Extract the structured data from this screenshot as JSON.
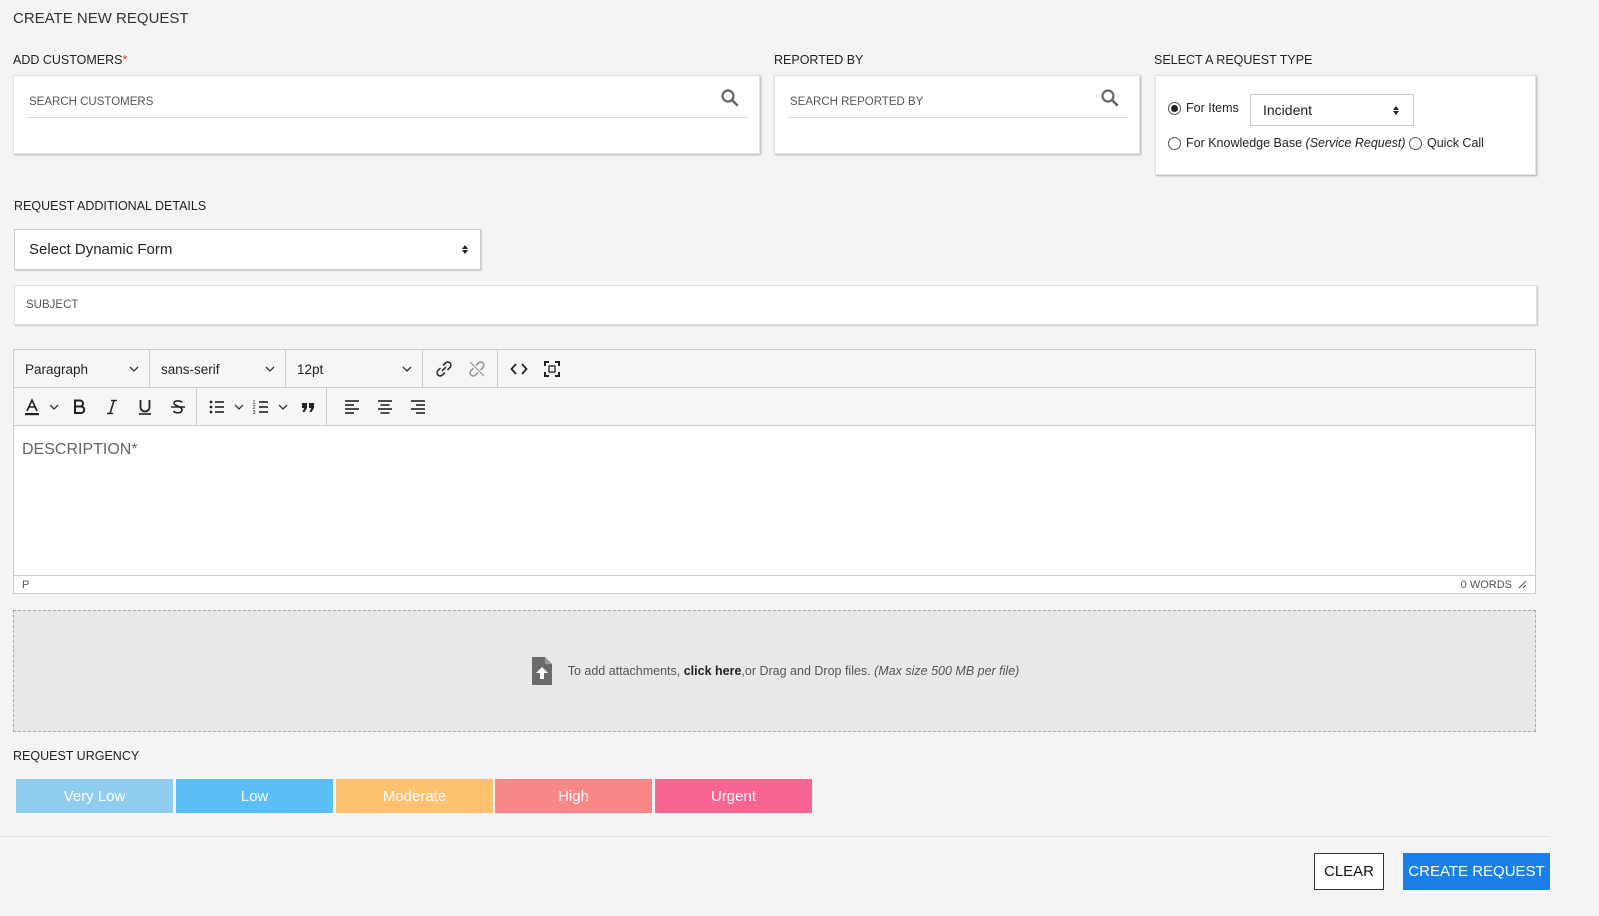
{
  "page": {
    "title": "CREATE NEW REQUEST"
  },
  "customers": {
    "label": "ADD CUSTOMERS",
    "required_mark": "*",
    "placeholder": "SEARCH CUSTOMERS"
  },
  "reported_by": {
    "label": "REPORTED BY",
    "placeholder": "SEARCH REPORTED BY"
  },
  "request_type": {
    "label": "SELECT A REQUEST TYPE",
    "option_items": "For Items",
    "option_items_selected": true,
    "items_select_value": "Incident",
    "option_kb": "For Knowledge Base",
    "option_kb_note": "(Service Request)",
    "option_quick": "Quick Call"
  },
  "additional": {
    "label": "REQUEST ADDITIONAL DETAILS",
    "dynamic_form_value": "Select Dynamic Form"
  },
  "subject": {
    "placeholder": "SUBJECT"
  },
  "editor": {
    "block_format": "Paragraph",
    "font_family": "sans-serif",
    "font_size": "12pt",
    "placeholder": "DESCRIPTION*",
    "path": "P",
    "word_count": "0 WORDS",
    "icons_row1": [
      "link-icon",
      "unlink-icon",
      "source-code-icon",
      "fullscreen-icon"
    ],
    "icons_row2": [
      "text-color-icon",
      "bold-icon",
      "italic-icon",
      "underline-icon",
      "strikethrough-icon",
      "bullet-list-icon",
      "numbered-list-icon",
      "blockquote-icon",
      "align-left-icon",
      "align-center-icon",
      "align-right-icon"
    ]
  },
  "attachments": {
    "prefix": "To add attachments, ",
    "link": "click here",
    "middle": ",or Drag and Drop files. ",
    "note": "(Max size 500 MB per file)"
  },
  "urgency": {
    "label": "REQUEST URGENCY",
    "levels": [
      {
        "label": "Very Low",
        "color": "#8fcdf0"
      },
      {
        "label": "Low",
        "color": "#5bbef5"
      },
      {
        "label": "Moderate",
        "color": "#fec170"
      },
      {
        "label": "High",
        "color": "#f98787"
      },
      {
        "label": "Urgent",
        "color": "#f76590"
      }
    ]
  },
  "actions": {
    "clear": "CLEAR",
    "create": "CREATE REQUEST"
  }
}
